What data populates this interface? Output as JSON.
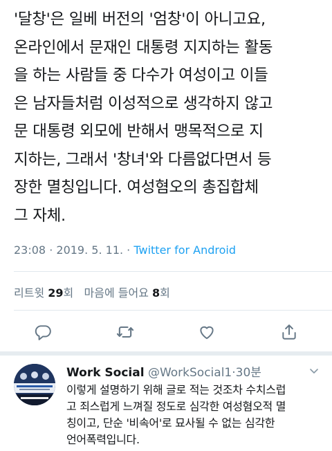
{
  "tweet": {
    "lines": [
      "'달창'은 일베 버전의 '엄창'이 아니고요,",
      "온라인에서 문재인 대통령 지지하는 활동",
      "을 하는 사람들 중 다수가 여성이고 이들",
      "은 남자들처럼 이성적으로 생각하지 않고",
      "문 대통령 외모에 반해서 맹목적으로 지",
      "지하는, 그래서 '창녀'와 다름없다면서 등",
      "장한 멸칭입니다. 여성혐오의 총집합체",
      "그 자체."
    ],
    "time": "23:08",
    "date": "2019. 5. 11.",
    "separator": "·",
    "via": "Twitter for Android"
  },
  "stats": {
    "retweets_label": "리트윗",
    "retweets_count": "29",
    "retweets_unit": "회",
    "likes_label": "마음에 들어요",
    "likes_count": "8",
    "likes_unit": "회"
  },
  "actions": {
    "icons": [
      "reply-icon",
      "retweet-icon",
      "like-icon",
      "share-icon"
    ]
  },
  "reply": {
    "name": "Work Social",
    "handle": "@WorkSocial1",
    "separator": "·",
    "time": "30분",
    "lines": [
      "이렇게 설명하기 위해 글로 적는 것조차 수치스럽",
      "고 죄스럽게 느껴질 정도로 심각한 여성혐오적 멸",
      "칭이고, 단순 '비속어'로 묘사될 수 없는 심각한",
      "언어폭력입니다."
    ]
  },
  "colors": {
    "text": "#14171a",
    "secondary": "#657786",
    "link": "#1da1f2",
    "divider": "#e1e8ed",
    "section_bg": "#e6ecf0"
  }
}
